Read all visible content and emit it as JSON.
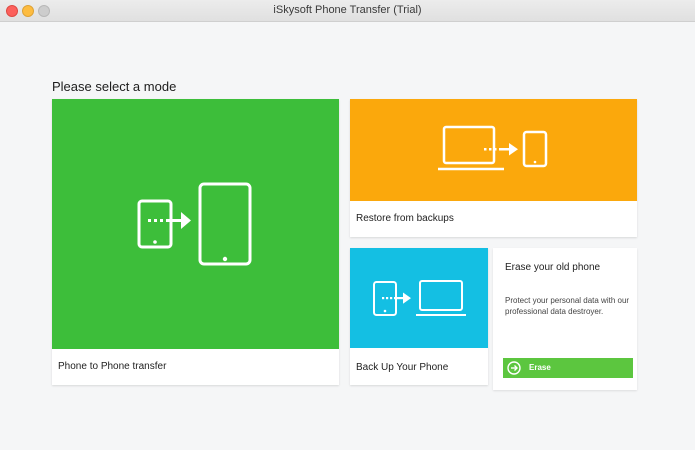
{
  "window": {
    "title": "iSkysoft Phone Transfer (Trial)"
  },
  "main": {
    "heading": "Please select a mode",
    "modes": [
      {
        "label": "Phone to Phone transfer",
        "icon": "phone-to-phone-icon",
        "color": "#3dbe3a"
      },
      {
        "label": "Restore from backups",
        "icon": "laptop-to-phone-icon",
        "color": "#fba80c"
      },
      {
        "label": "Back Up Your Phone",
        "icon": "phone-to-laptop-icon",
        "color": "#14bfe3"
      }
    ],
    "erase": {
      "title": "Erase your old phone",
      "description": "Protect your personal data with our professional data destroyer.",
      "button_label": "Erase",
      "button_color": "#5cc63f"
    }
  }
}
